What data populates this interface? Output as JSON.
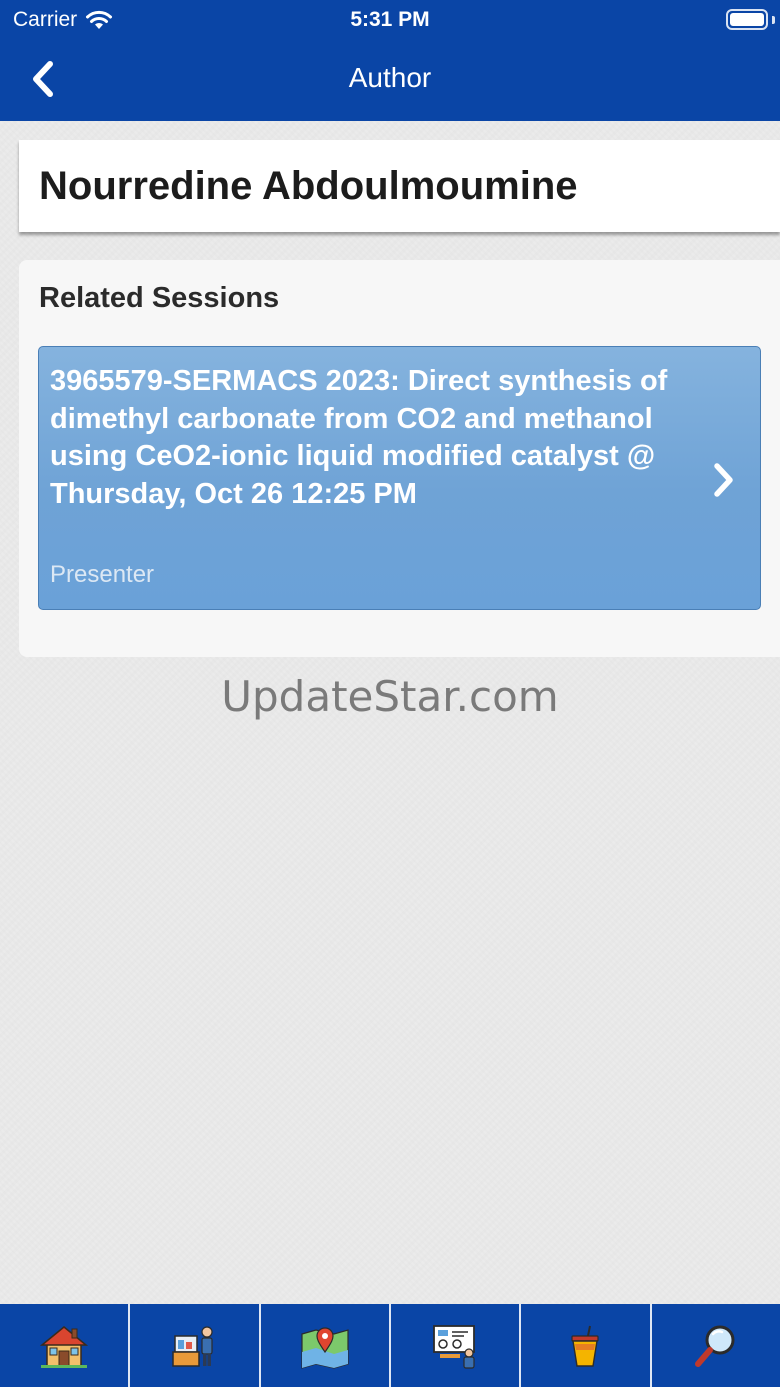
{
  "status_bar": {
    "carrier": "Carrier",
    "time": "5:31 PM"
  },
  "nav": {
    "title": "Author",
    "back_icon": "chevron-left-icon"
  },
  "author": {
    "name": "Nourredine Abdoulmoumine"
  },
  "related_sessions": {
    "heading": "Related Sessions",
    "items": [
      {
        "title": "3965579-SERMACS 2023: Direct synthesis of dimethyl carbonate from CO2 and methanol using CeO2-ionic liquid modified catalyst @ Thursday, Oct 26 12:25 PM",
        "role": "Presenter",
        "chevron_icon": "chevron-right-icon"
      }
    ]
  },
  "watermark": "UpdateStar.com",
  "tab_bar": {
    "tabs": [
      {
        "icon": "home-icon"
      },
      {
        "icon": "exhibitor-icon"
      },
      {
        "icon": "map-icon"
      },
      {
        "icon": "presentation-icon"
      },
      {
        "icon": "drink-icon"
      },
      {
        "icon": "search-icon"
      }
    ]
  },
  "colors": {
    "header_blue": "#0a45a6",
    "session_blue": "#6fa3d6"
  }
}
